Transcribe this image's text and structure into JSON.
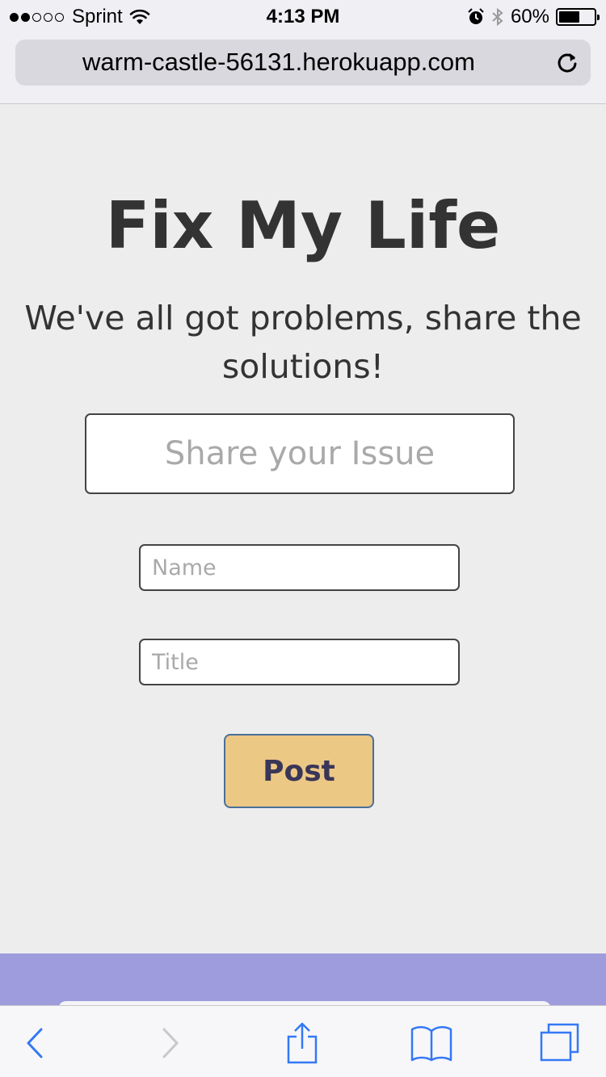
{
  "status_bar": {
    "carrier": "Sprint",
    "time": "4:13 PM",
    "battery": "60%",
    "battery_level": 0.6,
    "signal_bars_filled": 2,
    "signal_bars_total": 5,
    "icons": [
      "wifi-icon",
      "alarm-icon",
      "bluetooth-icon",
      "battery-icon"
    ]
  },
  "browser": {
    "url": "warm-castle-56131.herokuapp.com",
    "reload_icon": "reload-icon",
    "toolbar_icons": [
      "back-icon",
      "forward-icon",
      "share-icon",
      "bookmarks-icon",
      "tabs-icon"
    ]
  },
  "page": {
    "title": "Fix My Life",
    "tagline": "We've all got problems, share the solutions!",
    "issue_placeholder": "Share your Issue",
    "issue_value": "",
    "name_placeholder": "Name",
    "name_value": "",
    "title_placeholder": "Title",
    "title_value": "",
    "post_label": "Post"
  },
  "colors": {
    "background": "#ededed",
    "text": "#333333",
    "post_button": "#ecc885",
    "post_border": "#4a6f98",
    "post_text": "#3a3658",
    "footer_band": "#9e9cdc",
    "ios_blue": "#3478f6"
  }
}
